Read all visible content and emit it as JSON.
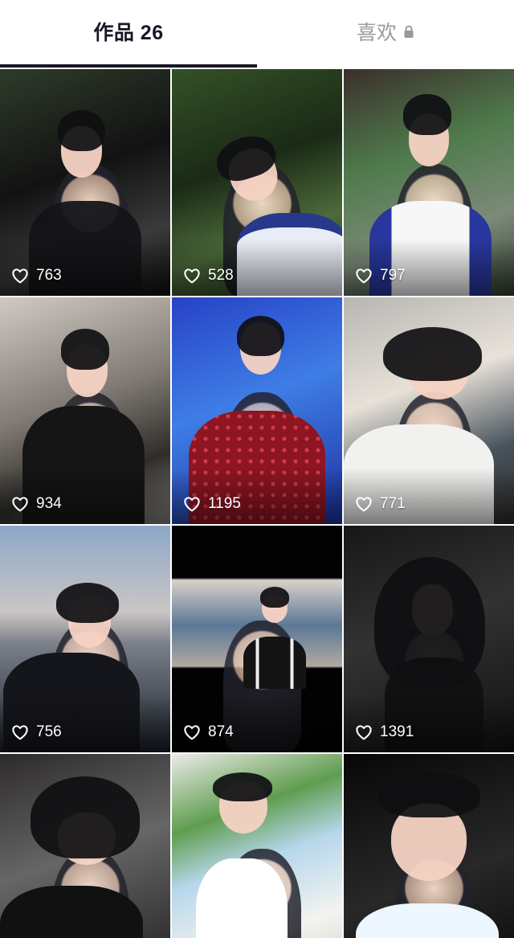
{
  "tabs": {
    "works_label": "作品 26",
    "likes_label": "喜欢"
  },
  "icons": {
    "lock": "lock-icon",
    "heart": "heart-outline-icon"
  },
  "videos": [
    {
      "likes": "763"
    },
    {
      "likes": "528"
    },
    {
      "likes": "797"
    },
    {
      "likes": "934"
    },
    {
      "likes": "1195"
    },
    {
      "likes": "771"
    },
    {
      "likes": "756"
    },
    {
      "likes": "874"
    },
    {
      "likes": "1391"
    },
    {
      "likes": ""
    },
    {
      "likes": ""
    },
    {
      "likes": ""
    }
  ]
}
